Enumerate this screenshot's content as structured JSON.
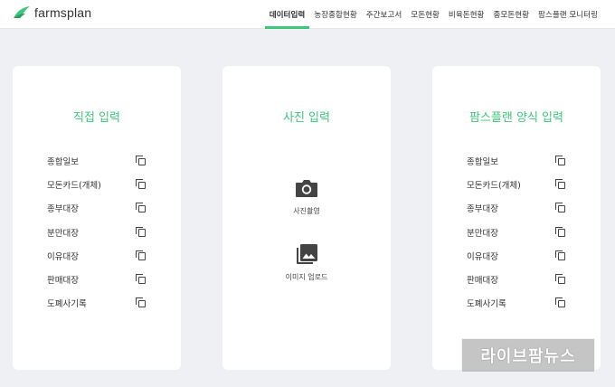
{
  "header": {
    "logo_text": "farmsplan",
    "nav": [
      {
        "label": "데이터입력",
        "active": true
      },
      {
        "label": "농장종합현황"
      },
      {
        "label": "주간보고서"
      },
      {
        "label": "모돈현황"
      },
      {
        "label": "비육돈현황"
      },
      {
        "label": "종모돈현황"
      },
      {
        "label": "팜스플랜 모니터링"
      }
    ]
  },
  "cards": {
    "direct": {
      "title": "직접 입력",
      "items": [
        "종합일보",
        "모돈카드(개체)",
        "종부대장",
        "분만대장",
        "이유대장",
        "판매대장",
        "도폐사기록"
      ]
    },
    "photo": {
      "title": "사진 입력",
      "camera_label": "사진촬영",
      "upload_label": "이미지 업로드"
    },
    "template": {
      "title": "팜스플랜 양식 입력",
      "items": [
        "종합일보",
        "모돈카드(개체)",
        "종부대장",
        "분만대장",
        "이유대장",
        "판매대장",
        "도폐사기록"
      ]
    }
  },
  "watermark": "라이브팜뉴스",
  "colors": {
    "accent": "#3ec77a",
    "background": "#eef0f3"
  }
}
